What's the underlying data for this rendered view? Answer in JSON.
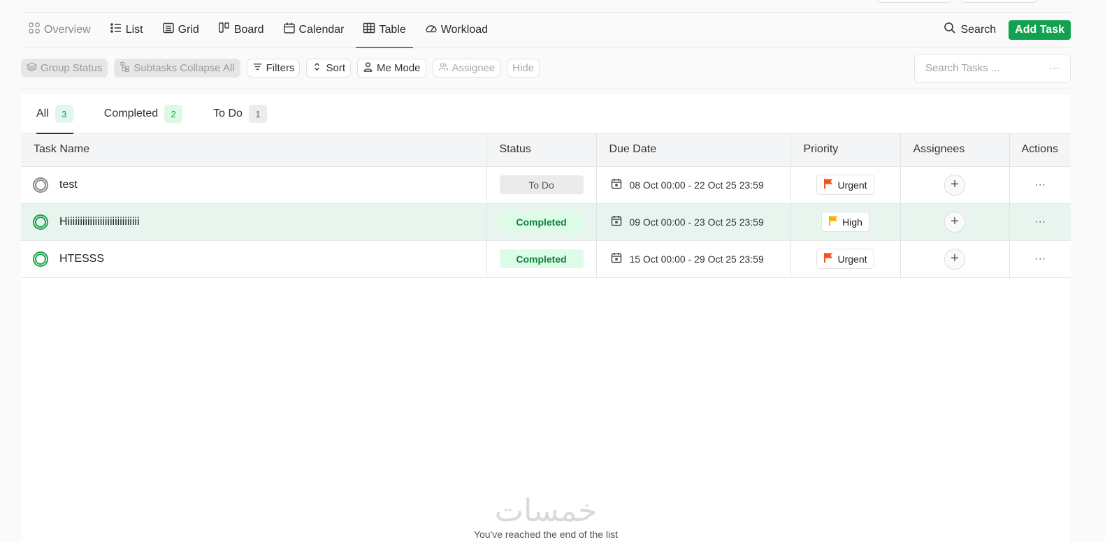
{
  "views": {
    "tabs": [
      {
        "label": "Overview"
      },
      {
        "label": "List"
      },
      {
        "label": "Grid"
      },
      {
        "label": "Board"
      },
      {
        "label": "Calendar"
      },
      {
        "label": "Table"
      },
      {
        "label": "Workload"
      }
    ],
    "active": "Table",
    "search_label": "Search",
    "add_task_label": "Add Task"
  },
  "toolbar": {
    "group_status": "Group Status",
    "subtasks": "Subtasks Collapse All",
    "filters": "Filters",
    "sort": "Sort",
    "me_mode": "Me Mode",
    "assignee": "Assignee",
    "hide": "Hide",
    "search_placeholder": "Search Tasks ...",
    "more": "···"
  },
  "filter_tabs": [
    {
      "label": "All",
      "count": "3"
    },
    {
      "label": "Completed",
      "count": "2"
    },
    {
      "label": "To Do",
      "count": "1"
    }
  ],
  "table": {
    "headers": [
      "Task Name",
      "Status",
      "Due Date",
      "Priority",
      "Assignees",
      "Actions"
    ],
    "rows": [
      {
        "name": "test",
        "status": "To Do",
        "due": "08 Oct 00:00 - 22 Oct 25 23:59",
        "priority": "Urgent",
        "priority_color": "#f4511e"
      },
      {
        "name": "Hiiiiiiiiiiiiiiiiiiiiiiiiiiiii",
        "status": "Completed",
        "due": "09 Oct 00:00 - 23 Oct 25 23:59",
        "priority": "High",
        "priority_color": "#f5b400"
      },
      {
        "name": "HTESSS",
        "status": "Completed",
        "due": "15 Oct 00:00 - 29 Oct 25 23:59",
        "priority": "Urgent",
        "priority_color": "#f4511e"
      }
    ],
    "actions_icon": "···"
  },
  "footer": {
    "logo_text": "خمسات",
    "end_message": "You've reached the end of the list"
  },
  "colors": {
    "accent": "#10a37f",
    "add_button": "#12a150",
    "selected_row": "#e8f5ef"
  }
}
